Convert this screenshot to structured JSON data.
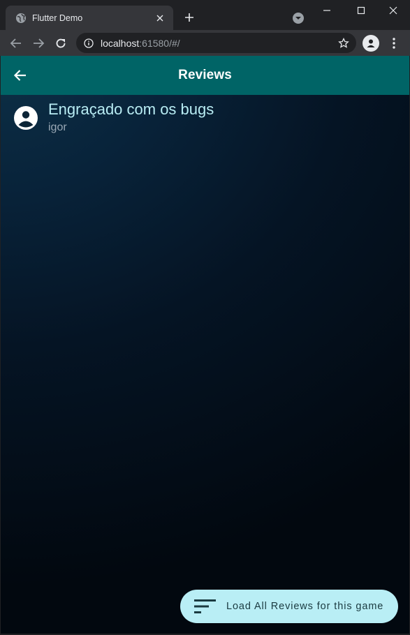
{
  "browser": {
    "tab_title": "Flutter Demo",
    "url_host": "localhost",
    "url_rest": ":61580/#/"
  },
  "app": {
    "title": "Reviews",
    "reviews": [
      {
        "title": "Engraçado com os bugs",
        "author": "igor"
      }
    ],
    "load_all_label": "Load All Reviews for this game"
  },
  "colors": {
    "appbar": "#006466",
    "fab": "#b9eef5",
    "review_title": "#b8ecf3"
  },
  "icons": {
    "back": "arrow-back-icon",
    "avatar": "account-circle-icon",
    "fab": "sort-icon"
  }
}
